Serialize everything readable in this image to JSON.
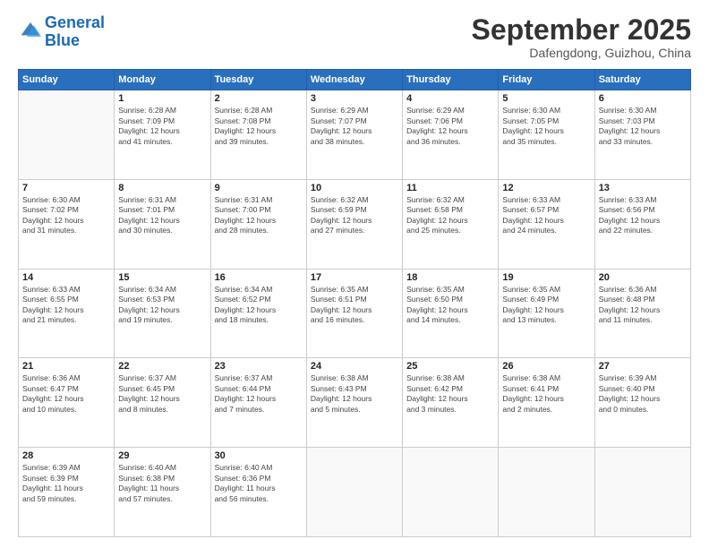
{
  "header": {
    "logo_line1": "General",
    "logo_line2": "Blue",
    "month": "September 2025",
    "location": "Dafengdong, Guizhou, China"
  },
  "weekdays": [
    "Sunday",
    "Monday",
    "Tuesday",
    "Wednesday",
    "Thursday",
    "Friday",
    "Saturday"
  ],
  "weeks": [
    [
      {
        "day": "",
        "detail": ""
      },
      {
        "day": "1",
        "detail": "Sunrise: 6:28 AM\nSunset: 7:09 PM\nDaylight: 12 hours\nand 41 minutes."
      },
      {
        "day": "2",
        "detail": "Sunrise: 6:28 AM\nSunset: 7:08 PM\nDaylight: 12 hours\nand 39 minutes."
      },
      {
        "day": "3",
        "detail": "Sunrise: 6:29 AM\nSunset: 7:07 PM\nDaylight: 12 hours\nand 38 minutes."
      },
      {
        "day": "4",
        "detail": "Sunrise: 6:29 AM\nSunset: 7:06 PM\nDaylight: 12 hours\nand 36 minutes."
      },
      {
        "day": "5",
        "detail": "Sunrise: 6:30 AM\nSunset: 7:05 PM\nDaylight: 12 hours\nand 35 minutes."
      },
      {
        "day": "6",
        "detail": "Sunrise: 6:30 AM\nSunset: 7:03 PM\nDaylight: 12 hours\nand 33 minutes."
      }
    ],
    [
      {
        "day": "7",
        "detail": "Sunrise: 6:30 AM\nSunset: 7:02 PM\nDaylight: 12 hours\nand 31 minutes."
      },
      {
        "day": "8",
        "detail": "Sunrise: 6:31 AM\nSunset: 7:01 PM\nDaylight: 12 hours\nand 30 minutes."
      },
      {
        "day": "9",
        "detail": "Sunrise: 6:31 AM\nSunset: 7:00 PM\nDaylight: 12 hours\nand 28 minutes."
      },
      {
        "day": "10",
        "detail": "Sunrise: 6:32 AM\nSunset: 6:59 PM\nDaylight: 12 hours\nand 27 minutes."
      },
      {
        "day": "11",
        "detail": "Sunrise: 6:32 AM\nSunset: 6:58 PM\nDaylight: 12 hours\nand 25 minutes."
      },
      {
        "day": "12",
        "detail": "Sunrise: 6:33 AM\nSunset: 6:57 PM\nDaylight: 12 hours\nand 24 minutes."
      },
      {
        "day": "13",
        "detail": "Sunrise: 6:33 AM\nSunset: 6:56 PM\nDaylight: 12 hours\nand 22 minutes."
      }
    ],
    [
      {
        "day": "14",
        "detail": "Sunrise: 6:33 AM\nSunset: 6:55 PM\nDaylight: 12 hours\nand 21 minutes."
      },
      {
        "day": "15",
        "detail": "Sunrise: 6:34 AM\nSunset: 6:53 PM\nDaylight: 12 hours\nand 19 minutes."
      },
      {
        "day": "16",
        "detail": "Sunrise: 6:34 AM\nSunset: 6:52 PM\nDaylight: 12 hours\nand 18 minutes."
      },
      {
        "day": "17",
        "detail": "Sunrise: 6:35 AM\nSunset: 6:51 PM\nDaylight: 12 hours\nand 16 minutes."
      },
      {
        "day": "18",
        "detail": "Sunrise: 6:35 AM\nSunset: 6:50 PM\nDaylight: 12 hours\nand 14 minutes."
      },
      {
        "day": "19",
        "detail": "Sunrise: 6:35 AM\nSunset: 6:49 PM\nDaylight: 12 hours\nand 13 minutes."
      },
      {
        "day": "20",
        "detail": "Sunrise: 6:36 AM\nSunset: 6:48 PM\nDaylight: 12 hours\nand 11 minutes."
      }
    ],
    [
      {
        "day": "21",
        "detail": "Sunrise: 6:36 AM\nSunset: 6:47 PM\nDaylight: 12 hours\nand 10 minutes."
      },
      {
        "day": "22",
        "detail": "Sunrise: 6:37 AM\nSunset: 6:45 PM\nDaylight: 12 hours\nand 8 minutes."
      },
      {
        "day": "23",
        "detail": "Sunrise: 6:37 AM\nSunset: 6:44 PM\nDaylight: 12 hours\nand 7 minutes."
      },
      {
        "day": "24",
        "detail": "Sunrise: 6:38 AM\nSunset: 6:43 PM\nDaylight: 12 hours\nand 5 minutes."
      },
      {
        "day": "25",
        "detail": "Sunrise: 6:38 AM\nSunset: 6:42 PM\nDaylight: 12 hours\nand 3 minutes."
      },
      {
        "day": "26",
        "detail": "Sunrise: 6:38 AM\nSunset: 6:41 PM\nDaylight: 12 hours\nand 2 minutes."
      },
      {
        "day": "27",
        "detail": "Sunrise: 6:39 AM\nSunset: 6:40 PM\nDaylight: 12 hours\nand 0 minutes."
      }
    ],
    [
      {
        "day": "28",
        "detail": "Sunrise: 6:39 AM\nSunset: 6:39 PM\nDaylight: 11 hours\nand 59 minutes."
      },
      {
        "day": "29",
        "detail": "Sunrise: 6:40 AM\nSunset: 6:38 PM\nDaylight: 11 hours\nand 57 minutes."
      },
      {
        "day": "30",
        "detail": "Sunrise: 6:40 AM\nSunset: 6:36 PM\nDaylight: 11 hours\nand 56 minutes."
      },
      {
        "day": "",
        "detail": ""
      },
      {
        "day": "",
        "detail": ""
      },
      {
        "day": "",
        "detail": ""
      },
      {
        "day": "",
        "detail": ""
      }
    ]
  ]
}
